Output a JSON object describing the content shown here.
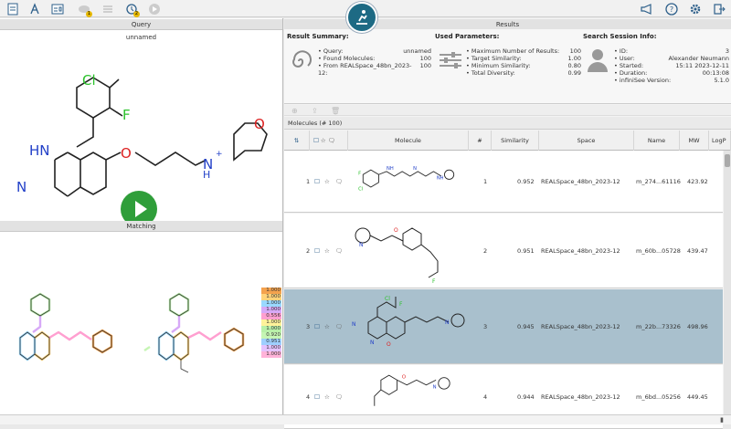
{
  "toolbar": {
    "badge_history": "2",
    "badge_tasks": "1"
  },
  "query": {
    "header": "Query",
    "name": "unnamed"
  },
  "matching": {
    "header": "Matching",
    "legend": [
      {
        "value": "1.000",
        "color": "#f4a24d"
      },
      {
        "value": "1.000",
        "color": "#ffd37a"
      },
      {
        "value": "1.000",
        "color": "#9ad9ff"
      },
      {
        "value": "1.000",
        "color": "#d7a9f7"
      },
      {
        "value": "0.556",
        "color": "#ff9fd0"
      },
      {
        "value": "1.000",
        "color": "#fff29a"
      },
      {
        "value": "1.000",
        "color": "#b8f0a8"
      },
      {
        "value": "0.920",
        "color": "#c6f5b4"
      },
      {
        "value": "0.951",
        "color": "#9ecfff"
      },
      {
        "value": "1.000",
        "color": "#e4c2ff"
      },
      {
        "value": "1.000",
        "color": "#ffb3d9"
      }
    ]
  },
  "results": {
    "header": "Results",
    "summary": {
      "title": "Result Summary:",
      "items": [
        {
          "k": "Query:",
          "v": "unnamed"
        },
        {
          "k": "Found Molecules:",
          "v": "100"
        },
        {
          "k": "From REALSpace_48bn_2023-12:",
          "v": "100"
        }
      ]
    },
    "params": {
      "title": "Used Parameters:",
      "items": [
        {
          "k": "Maximum Number of Results:",
          "v": "100"
        },
        {
          "k": "Target Similarity:",
          "v": "1.00"
        },
        {
          "k": "Minimum Similarity:",
          "v": "0.80"
        },
        {
          "k": "Total Diversity:",
          "v": "0.99"
        }
      ]
    },
    "session": {
      "title": "Search Session Info:",
      "items": [
        {
          "k": "ID:",
          "v": "3"
        },
        {
          "k": "User:",
          "v": "Alexander Neumann"
        },
        {
          "k": "Started:",
          "v": "15:11 2023-12-11"
        },
        {
          "k": "Duration:",
          "v": "00:13:08"
        },
        {
          "k": "infiniSee Version:",
          "v": "5.1.0"
        }
      ]
    },
    "molecules_label": "Molecules (# 100)",
    "columns": [
      "Molecule",
      "#",
      "Similarity",
      "Space",
      "Name",
      "MW",
      "LogP"
    ],
    "rows": [
      {
        "idx": "1",
        "num": "1",
        "sim": "0.952",
        "space": "REALSpace_48bn_2023-12",
        "name": "m_274...61116",
        "mw": "423.92"
      },
      {
        "idx": "2",
        "num": "2",
        "sim": "0.951",
        "space": "REALSpace_48bn_2023-12",
        "name": "m_60b...05728",
        "mw": "439.47"
      },
      {
        "idx": "3",
        "num": "3",
        "sim": "0.945",
        "space": "REALSpace_48bn_2023-12",
        "name": "m_22b...73326",
        "mw": "498.96"
      },
      {
        "idx": "4",
        "num": "4",
        "sim": "0.944",
        "space": "REALSpace_48bn_2023-12",
        "name": "m_6bd...05256",
        "mw": "449.45"
      }
    ]
  },
  "colors": {
    "accent": "#1d6a84",
    "selected_row": "#a9c0cd",
    "play": "#2f9e3a"
  }
}
